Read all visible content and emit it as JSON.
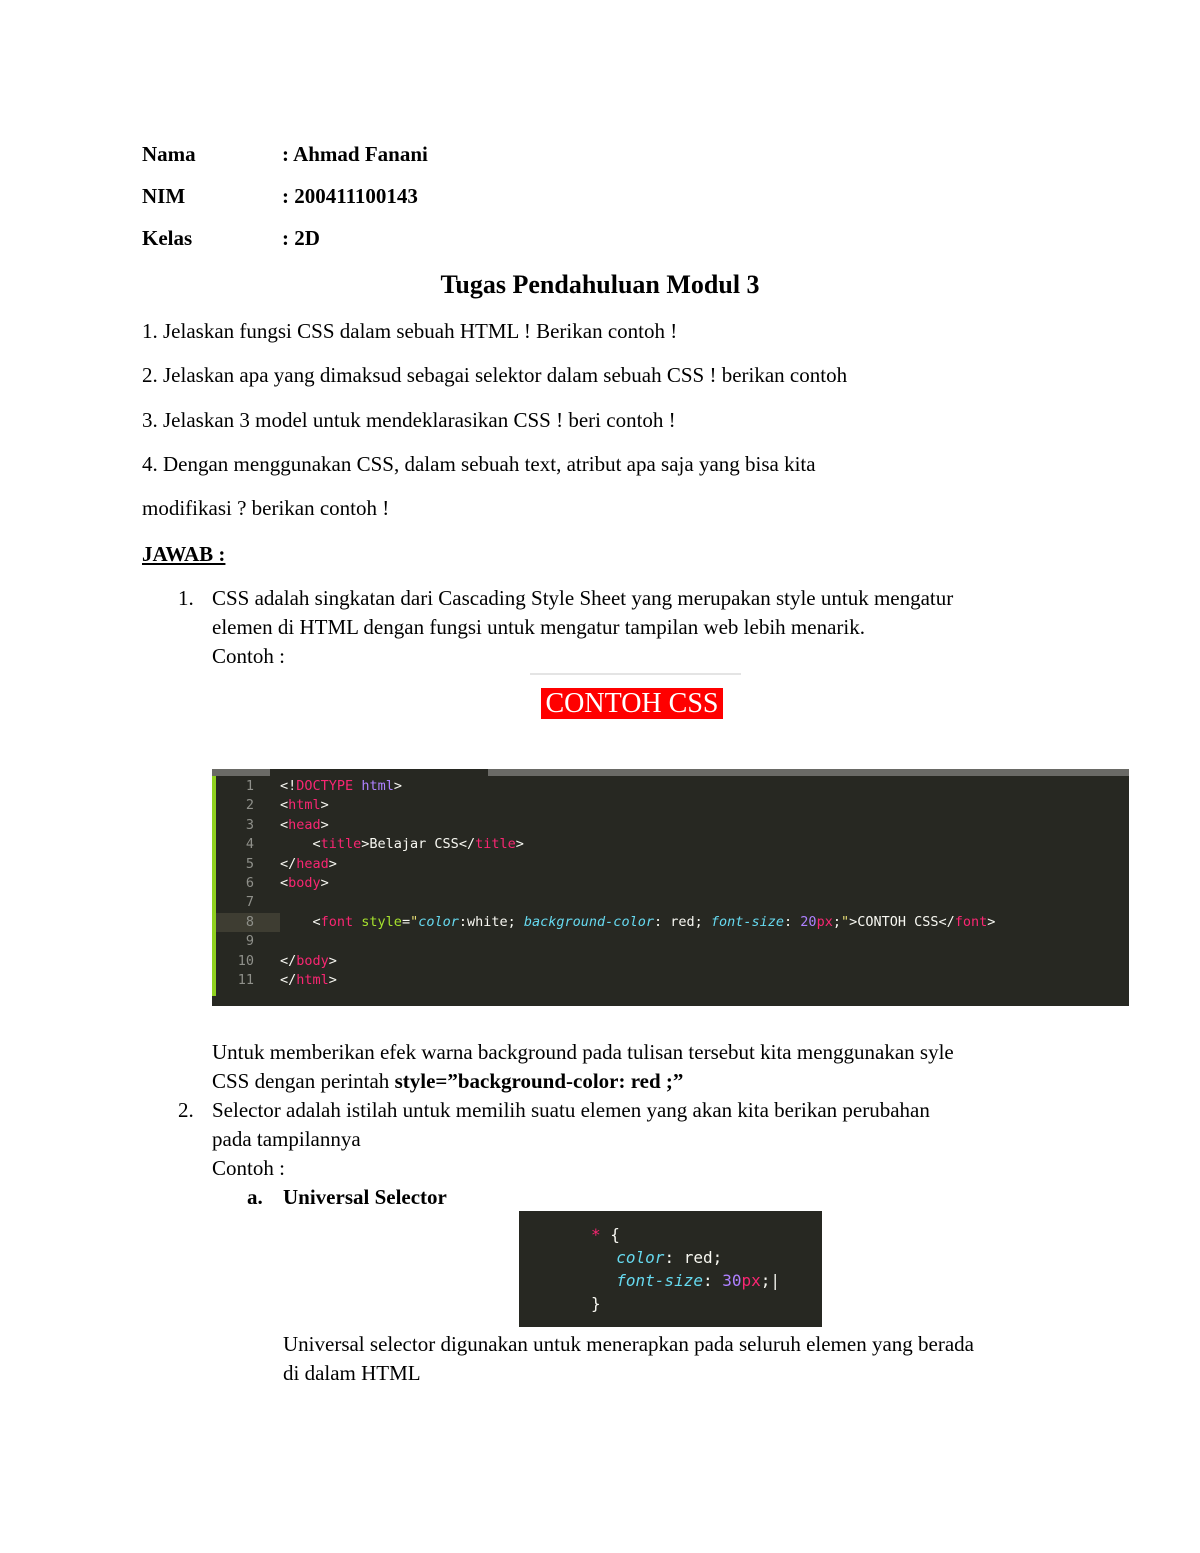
{
  "header": {
    "rows": [
      {
        "label": "Nama",
        "value": ": Ahmad Fanani"
      },
      {
        "label": "NIM",
        "value": ": 200411100143"
      },
      {
        "label": "Kelas",
        "value": ": 2D"
      }
    ]
  },
  "title": "Tugas Pendahuluan Modul 3",
  "questions": [
    "1. Jelaskan fungsi CSS dalam sebuah HTML ! Berikan contoh !",
    "2. Jelaskan apa yang dimaksud sebagai selektor dalam sebuah CSS ! berikan contoh",
    "3. Jelaskan 3 model untuk mendeklarasikan CSS ! beri contoh !",
    "4. Dengan menggunakan CSS, dalam sebuah text, atribut apa saja yang bisa kita",
    "modifikasi ? berikan contoh !"
  ],
  "answer_heading": "JAWAB :",
  "answers": {
    "a1": {
      "number": "1.",
      "lines": [
        "CSS adalah singkatan dari Cascading Style Sheet yang merupakan style untuk mengatur",
        "elemen di HTML dengan fungsi untuk mengatur tampilan web lebih menarik.",
        "Contoh :"
      ],
      "demo_text": "CONTOH CSS",
      "after_lines": [
        "Untuk memberikan efek warna background pada tulisan tersebut kita menggunakan syle"
      ],
      "after_prefix": "CSS dengan perintah ",
      "after_bold": "style=”background-color: red ;”"
    },
    "a2": {
      "number": "2.",
      "lines": [
        "Selector adalah istilah untuk memilih suatu elemen yang akan kita berikan perubahan",
        "pada tampilannya",
        "Contoh :"
      ],
      "sub_letter": "a.",
      "sub_title": "Universal Selector",
      "sub_lines": [
        "Universal selector digunakan untuk menerapkan pada seluruh elemen yang berada",
        "di dalam HTML"
      ]
    }
  },
  "colors": {
    "demo_bg": "#ff0000",
    "editor_bg": "#272822",
    "tag": "#f92672",
    "attr": "#a6e22e",
    "string": "#e6db74",
    "property": "#66d9ef",
    "number": "#ae81ff"
  },
  "code1": [
    [
      [
        "p",
        "<!"
      ],
      [
        "t",
        "DOCTYPE"
      ],
      [
        "p",
        " "
      ],
      [
        "k",
        "html"
      ],
      [
        "p",
        ">"
      ]
    ],
    [
      [
        "p",
        "<"
      ],
      [
        "t",
        "html"
      ],
      [
        "p",
        ">"
      ]
    ],
    [
      [
        "p",
        "<"
      ],
      [
        "t",
        "head"
      ],
      [
        "p",
        ">"
      ]
    ],
    [
      [
        "p",
        "    <"
      ],
      [
        "t",
        "title"
      ],
      [
        "p",
        ">Belajar CSS</"
      ],
      [
        "t",
        "title"
      ],
      [
        "p",
        ">"
      ]
    ],
    [
      [
        "p",
        "</"
      ],
      [
        "t",
        "head"
      ],
      [
        "p",
        ">"
      ]
    ],
    [
      [
        "p",
        "<"
      ],
      [
        "t",
        "body"
      ],
      [
        "p",
        ">"
      ]
    ],
    [],
    [
      [
        "p",
        "    <"
      ],
      [
        "t",
        "font"
      ],
      [
        "p",
        " "
      ],
      [
        "a",
        "style"
      ],
      [
        "p",
        "="
      ],
      [
        "s",
        "\""
      ],
      [
        "pr",
        "color"
      ],
      [
        "p",
        ":"
      ],
      [
        "v",
        "white"
      ],
      [
        "p",
        "; "
      ],
      [
        "pr",
        "background-color"
      ],
      [
        "p",
        ": "
      ],
      [
        "v",
        "red"
      ],
      [
        "p",
        "; "
      ],
      [
        "pr",
        "font-size"
      ],
      [
        "p",
        ": "
      ],
      [
        "n",
        "20"
      ],
      [
        "u",
        "px"
      ],
      [
        "p",
        ";"
      ],
      [
        "s",
        "\""
      ],
      [
        "p",
        ">CONTOH CSS</"
      ],
      [
        "t",
        "font"
      ],
      [
        "p",
        ">"
      ]
    ],
    [],
    [
      [
        "p",
        "</"
      ],
      [
        "t",
        "body"
      ],
      [
        "p",
        ">"
      ]
    ],
    [
      [
        "p",
        "</"
      ],
      [
        "t",
        "html"
      ],
      [
        "p",
        ">"
      ]
    ]
  ],
  "code1_numbers": [
    "1",
    "2",
    "3",
    "4",
    "5",
    "6",
    "7",
    "8",
    "9",
    "10",
    "11"
  ],
  "code2": [
    [
      [
        "t",
        "* "
      ],
      [
        "p",
        "{"
      ]
    ],
    [
      [
        "p",
        "  "
      ],
      [
        "pr",
        "color"
      ],
      [
        "p",
        ": "
      ],
      [
        "v",
        "red"
      ],
      [
        "p",
        ";"
      ]
    ],
    [
      [
        "p",
        "  "
      ],
      [
        "pr",
        "font-size"
      ],
      [
        "p",
        ": "
      ],
      [
        "n",
        "30"
      ],
      [
        "u",
        "px"
      ],
      [
        "p",
        ";|"
      ]
    ],
    [
      [
        "p",
        "}"
      ]
    ]
  ]
}
